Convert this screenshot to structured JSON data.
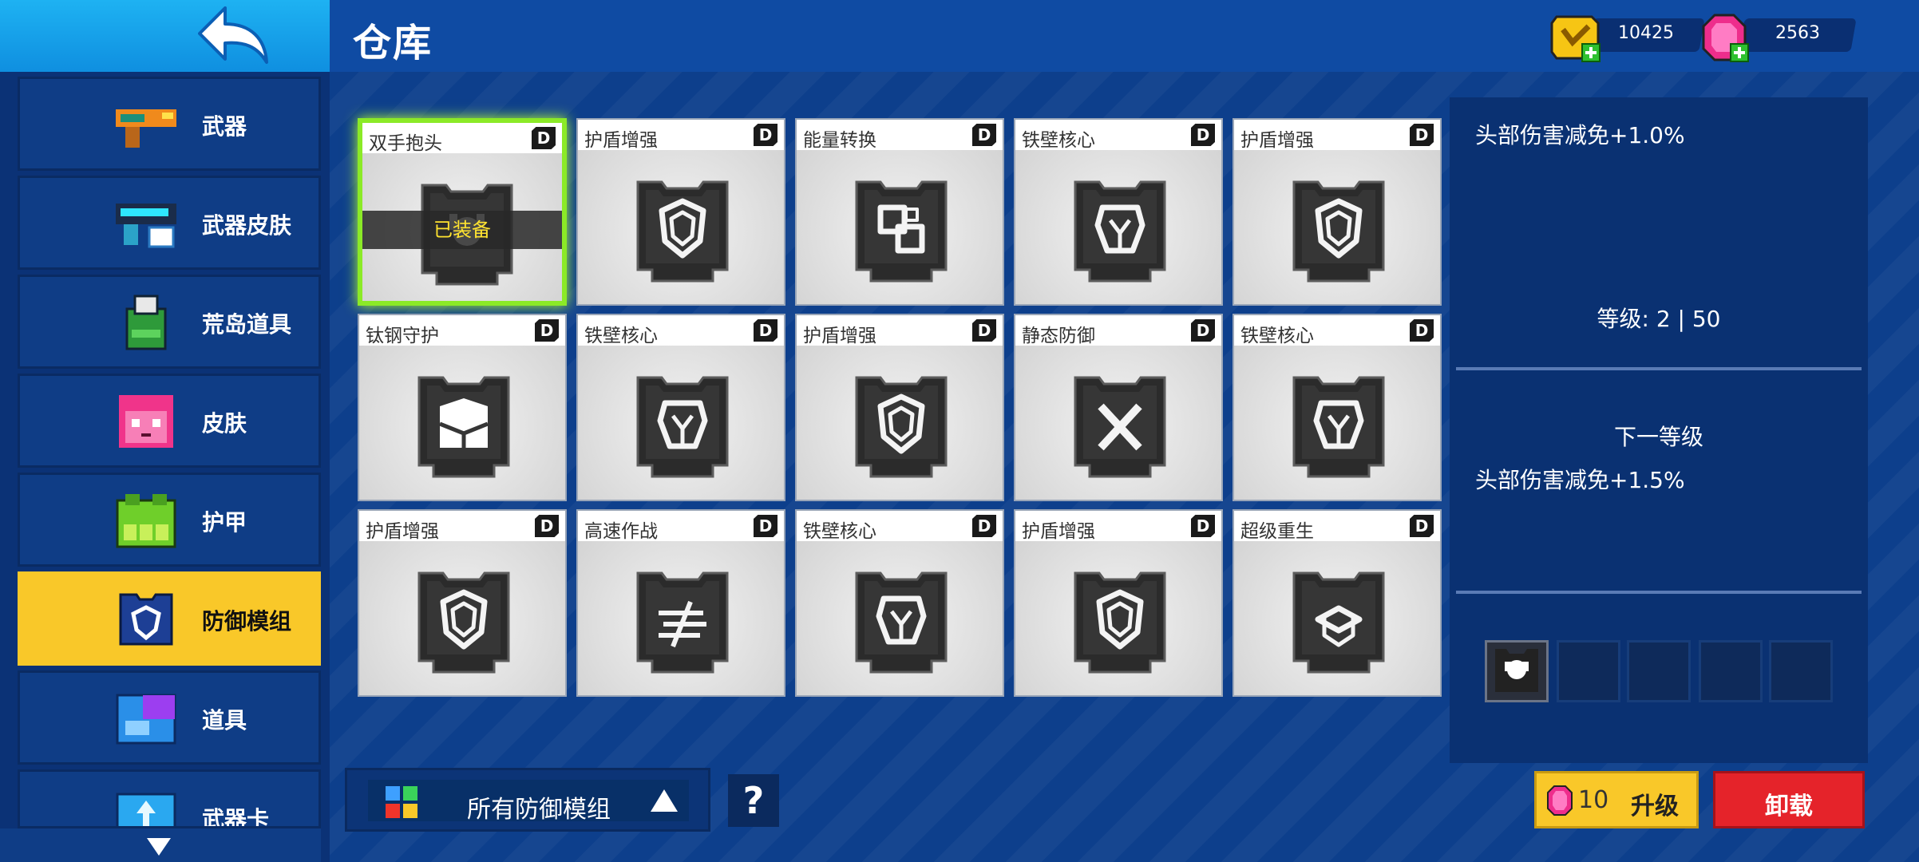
{
  "header": {
    "title": "仓库"
  },
  "currency": {
    "coins": "10425",
    "gems": "2563"
  },
  "sidebar": {
    "items": [
      {
        "label": "武器",
        "icon": "gun-icon"
      },
      {
        "label": "武器皮肤",
        "icon": "weapon-skin-icon"
      },
      {
        "label": "荒岛道具",
        "icon": "island-gear-icon"
      },
      {
        "label": "皮肤",
        "icon": "skin-face-icon"
      },
      {
        "label": "护甲",
        "icon": "armor-vest-icon"
      },
      {
        "label": "防御模组",
        "icon": "defense-module-icon",
        "active": true
      },
      {
        "label": "道具",
        "icon": "gadget-box-icon"
      },
      {
        "label": "武器卡",
        "icon": "weapon-card-icon"
      }
    ]
  },
  "modules": [
    {
      "name": "双手抱头",
      "grade": "D",
      "icon": "hands-head-icon",
      "equipped_label": "已装备"
    },
    {
      "name": "护盾增强",
      "grade": "D",
      "icon": "shield-icon"
    },
    {
      "name": "能量转换",
      "grade": "D",
      "icon": "energy-convert-icon"
    },
    {
      "name": "铁壁核心",
      "grade": "D",
      "icon": "iron-core-icon"
    },
    {
      "name": "护盾增强",
      "grade": "D",
      "icon": "shield-icon"
    },
    {
      "name": "钛钢守护",
      "grade": "D",
      "icon": "titanium-guard-icon"
    },
    {
      "name": "铁壁核心",
      "grade": "D",
      "icon": "iron-core-icon"
    },
    {
      "name": "护盾增强",
      "grade": "D",
      "icon": "shield-icon"
    },
    {
      "name": "静态防御",
      "grade": "D",
      "icon": "static-defense-icon"
    },
    {
      "name": "铁壁核心",
      "grade": "D",
      "icon": "iron-core-icon"
    },
    {
      "name": "护盾增强",
      "grade": "D",
      "icon": "shield-icon"
    },
    {
      "name": "高速作战",
      "grade": "D",
      "icon": "high-speed-icon"
    },
    {
      "name": "铁壁核心",
      "grade": "D",
      "icon": "iron-core-icon"
    },
    {
      "name": "护盾增强",
      "grade": "D",
      "icon": "shield-icon"
    },
    {
      "name": "超级重生",
      "grade": "D",
      "icon": "super-revive-icon"
    }
  ],
  "details": {
    "current_stat": "头部伤害减免+1.0%",
    "level": "等级: 2 | 50",
    "next_level_title": "下一等级",
    "next_stat": "头部伤害减免+1.5%"
  },
  "filter": {
    "label": "所有防御模组"
  },
  "help_label": "?",
  "actions": {
    "upgrade_cost": "10",
    "upgrade_label": "升级",
    "uninstall_label": "卸载"
  }
}
